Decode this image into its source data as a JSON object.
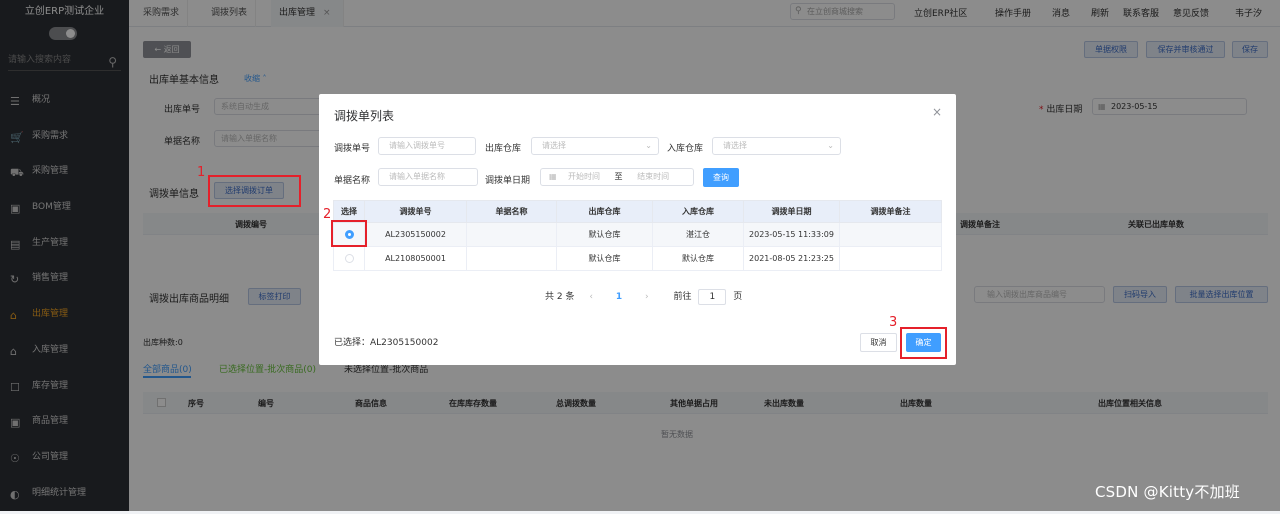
{
  "app": {
    "brand": "立创ERP测试企业",
    "search_placeholder": "请输入搜索内容"
  },
  "sidebar": {
    "items": [
      {
        "label": "概况",
        "icon": "list-icon"
      },
      {
        "label": "采购需求",
        "icon": "cart-icon"
      },
      {
        "label": "采购管理",
        "icon": "truck-icon"
      },
      {
        "label": "BOM管理",
        "icon": "bom-icon"
      },
      {
        "label": "生产管理",
        "icon": "document-icon"
      },
      {
        "label": "销售管理",
        "icon": "sales-icon"
      },
      {
        "label": "出库管理",
        "icon": "outbound-icon"
      },
      {
        "label": "入库管理",
        "icon": "inbound-icon"
      },
      {
        "label": "库存管理",
        "icon": "inventory-icon"
      },
      {
        "label": "商品管理",
        "icon": "product-icon"
      },
      {
        "label": "公司管理",
        "icon": "company-icon"
      },
      {
        "label": "明细统计管理",
        "icon": "stats-icon"
      }
    ]
  },
  "tabs": [
    {
      "label": "采购需求"
    },
    {
      "label": "调拨列表"
    },
    {
      "label": "出库管理",
      "close": "×"
    }
  ],
  "topbar": {
    "search_placeholder": "在立创商城搜索",
    "links": [
      "立创ERP社区",
      "操作手册",
      "消息",
      "刷新",
      "联系客服",
      "意见反馈",
      "韦子汐"
    ]
  },
  "page": {
    "back": "返回",
    "actions": [
      "单据权限",
      "保存并审核通过",
      "保存"
    ],
    "basic_title": "出库单基本信息",
    "collapse": "收缩",
    "order_no_label": "出库单号",
    "order_no_placeholder": "系统自动生成",
    "doc_name_label": "单据名称",
    "doc_name_placeholder": "请输入单据名称",
    "date_label": "出库日期",
    "date_value": "2023-05-15",
    "transfer_info_title": "调拨单信息",
    "select_transfer_btn": "选择调拨订单",
    "transfer_cols": [
      "调拨编号",
      "调拨单备注",
      "关联已出库单数"
    ],
    "detail_title": "调拨出库商品明细",
    "print_btn": "标签打印",
    "detail_search_placeholder": "输入调拨出库商品编号",
    "scan_btn": "扫码导入",
    "batch_btn": "批量选择出库位置",
    "kinds": "出库种数:0",
    "subtabs": [
      "全部商品(0)",
      "已选择位置-批次商品(0)",
      "未选择位置-批次商品"
    ],
    "grid_cols": [
      "序号",
      "编号",
      "商品信息",
      "在库库存数量",
      "总调拨数量",
      "其他单据占用",
      "未出库数量",
      "出库数量",
      "出库位置相关信息"
    ],
    "empty": "暂无数据"
  },
  "dialog": {
    "title": "调拨单列表",
    "close": "×",
    "f_no_label": "调拨单号",
    "f_no_placeholder": "请输入调拨单号",
    "f_out_label": "出库仓库",
    "f_out_placeholder": "请选择",
    "f_in_label": "入库仓库",
    "f_in_placeholder": "请选择",
    "f_name_label": "单据名称",
    "f_name_placeholder": "请输入单据名称",
    "f_date_label": "调拨单日期",
    "f_date_start": "开始时间",
    "f_date_to": "至",
    "f_date_end": "结束时间",
    "query": "查询",
    "columns": [
      "选择",
      "调拨单号",
      "单据名称",
      "出库仓库",
      "入库仓库",
      "调拨单日期",
      "调拨单备注"
    ],
    "rows": [
      {
        "selected": true,
        "no": "AL2305150002",
        "name": "",
        "out": "默认仓库",
        "in": "湛江仓",
        "date": "2023-05-15 11:33:09",
        "remark": ""
      },
      {
        "selected": false,
        "no": "AL2108050001",
        "name": "",
        "out": "默认仓库",
        "in": "默认仓库",
        "date": "2021-08-05 21:23:25",
        "remark": ""
      }
    ],
    "pager": {
      "total": "共 2 条",
      "prev": "‹",
      "page": "1",
      "next": "›",
      "goto": "前往",
      "page_input": "1",
      "page_suffix": "页"
    },
    "selected_text": "已选择：AL2305150002",
    "cancel": "取消",
    "confirm": "确定"
  },
  "annotations": [
    "1",
    "2",
    "3"
  ],
  "watermark": "CSDN @Kitty不加班",
  "colors": {
    "primary": "#409eff",
    "annotation": "#e5202a",
    "active_nav": "#f5a623"
  }
}
